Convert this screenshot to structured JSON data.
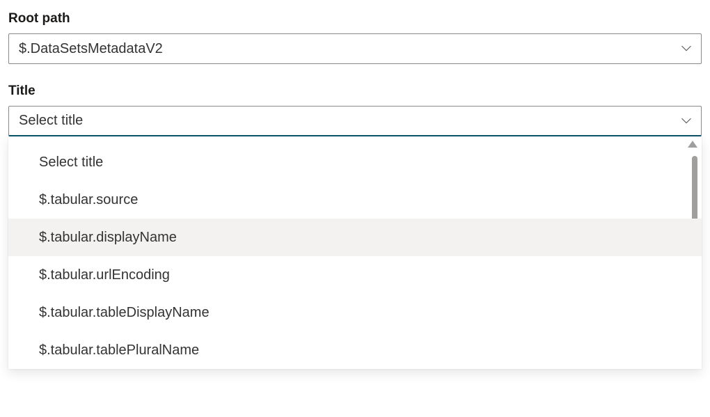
{
  "root_path": {
    "label": "Root path",
    "value": "$.DataSetsMetadataV2"
  },
  "title": {
    "label": "Title",
    "placeholder": "Select title",
    "highlighted_index": 2,
    "options": [
      "Select title",
      "$.tabular.source",
      "$.tabular.displayName",
      "$.tabular.urlEncoding",
      "$.tabular.tableDisplayName",
      "$.tabular.tablePluralName"
    ]
  }
}
